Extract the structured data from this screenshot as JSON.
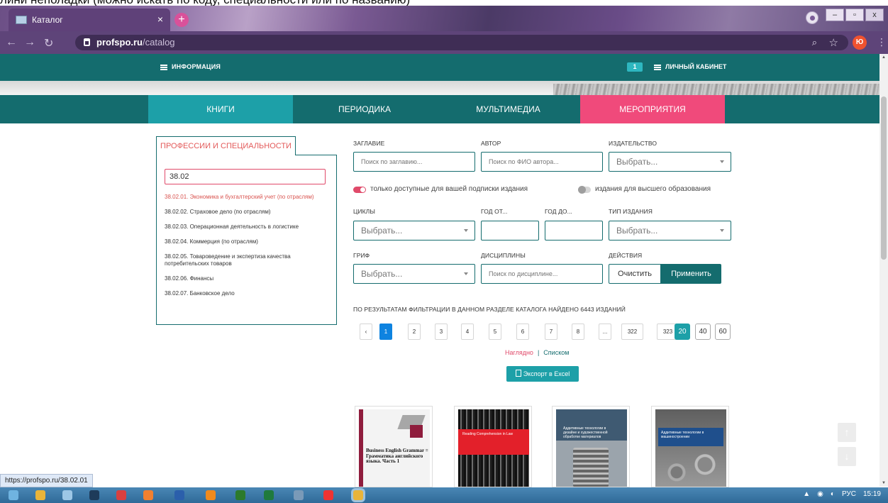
{
  "caption": "лини неполадки (можно искать по коду, специальности или по названию)",
  "browser": {
    "tab_title": "Каталог",
    "tab_close": "×",
    "new_tab": "+",
    "url_host": "profspo.ru",
    "url_path": "/catalog",
    "avatar_letter": "Ю",
    "status_url": "https://profspo.ru/38.02.01",
    "win_minimize": "–",
    "win_restore": "▫",
    "win_close": "x"
  },
  "site": {
    "info_label": "ИНФОРМАЦИЯ",
    "video_badge": "1",
    "cabinet_label": "ЛИЧНЫЙ КАБИНЕТ",
    "categories": [
      "КНИГИ",
      "ПЕРИОДИКА",
      "МУЛЬТИМЕДИА",
      "МЕРОПРИЯТИЯ"
    ]
  },
  "sidebar": {
    "tab_label": "ПРОФЕССИИ И СПЕЦИАЛЬНОСТИ",
    "search_value": "38.02",
    "items": [
      "38.02.01. Экономика и бухгалтерский учет (по отраслям)",
      "38.02.02. Страховое дело (по отраслям)",
      "38.02.03. Операционная деятельность в логистике",
      "38.02.04. Коммерция (по отраслям)",
      "38.02.05. Товароведение и экспертиза качества потребительских товаров",
      "38.02.06. Финансы",
      "38.02.07. Банковское дело"
    ]
  },
  "filters": {
    "title_label": "ЗАГЛАВИЕ",
    "title_placeholder": "Поиск по заглавию...",
    "author_label": "АВТОР",
    "author_placeholder": "Поиск по ФИО автора...",
    "publisher_label": "ИЗДАТЕЛЬСТВО",
    "select_placeholder": "Выбрать...",
    "toggle_available": "только доступные для вашей подписки издания",
    "toggle_higher": "издания для высшего образования",
    "cycles_label": "ЦИКЛЫ",
    "year_from_label": "ГОД ОТ...",
    "year_to_label": "ГОД ДО...",
    "edition_type_label": "ТИП ИЗДАНИЯ",
    "grif_label": "ГРИФ",
    "disciplines_label": "ДИСЦИПЛИНЫ",
    "disciplines_placeholder": "Поиск по дисциплине...",
    "actions_label": "ДЕЙСТВИЯ",
    "clear_label": "Очистить",
    "apply_label": "Применить"
  },
  "results": {
    "summary": "ПО РЕЗУЛЬТАТАМ ФИЛЬТРАЦИИ В ДАННОМ РАЗДЕЛЕ КАТАЛОГА НАЙДЕНО 6443 ИЗДАНИЙ",
    "prev": "‹",
    "pages": [
      "1",
      "2",
      "3",
      "4",
      "5",
      "6",
      "7",
      "8",
      "...",
      "322",
      "323"
    ],
    "per_page": [
      "20",
      "40",
      "60"
    ],
    "view_visual": "Наглядно",
    "view_separator": "|",
    "view_list": "Списком",
    "export_label": "Экспорт в Excel"
  },
  "books": [
    {
      "title": "Business English Grammar = Грамматика английского языка. Часть 1"
    },
    {
      "title": "Reading Comprehension in Law"
    },
    {
      "title": "Аддитивные технологии в дизайне и художественной обработке материалов"
    },
    {
      "title": "Аддитивные технологии в машиностроении"
    }
  ],
  "scroll": {
    "up": "↑",
    "down": "↓"
  },
  "tray": {
    "lang": "РУС",
    "time": "15:19"
  }
}
